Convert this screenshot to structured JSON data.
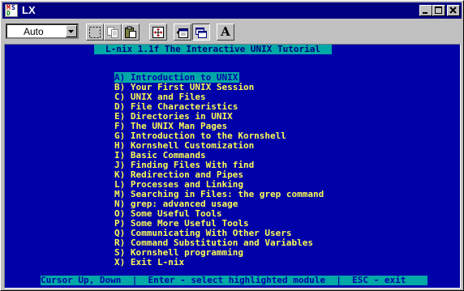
{
  "window": {
    "title": "LX",
    "app_icon_text": [
      "M",
      "S",
      "D"
    ]
  },
  "toolbar": {
    "font_size_value": "Auto",
    "text_tool_glyph": "A",
    "tools": [
      "mark-icon",
      "copy-icon",
      "paste-icon",
      "fullscreen-icon",
      "properties-icon",
      "background-icon",
      "font-icon"
    ]
  },
  "terminal": {
    "header": "L-nix 1.1f The Interactive UNIX Tutorial",
    "status": "Cursor Up, Down  |  Enter - select highlighted module  |  ESC - exit",
    "selected_index": 0,
    "menu": [
      "A) Introduction to UNIX",
      "B) Your First UNIX Session",
      "C) UNIX and Files",
      "D) File Characteristics",
      "E) Directories in UNIX",
      "F) The UNIX Man Pages",
      "G) Introduction to the Kornshell",
      "H) Kornshell Customization",
      "I) Basic Commands",
      "J) Finding Files With find",
      "K) Redirection and Pipes",
      "L) Processes and Linking",
      "M) Searching in Files: the grep command",
      "N) grep: advanced usage",
      "O) Some Useful Tools",
      "P) Some More Useful Tools",
      "Q) Communicating With Other Users",
      "R) Command Substitution and Variables",
      "S) Kornshell programming",
      "X) Exit L-nix"
    ]
  },
  "colors": {
    "title_bar": "#000080",
    "terminal_bg": "#0000a8",
    "menu_text": "#fcfc54",
    "highlight": "#00a8a8"
  }
}
